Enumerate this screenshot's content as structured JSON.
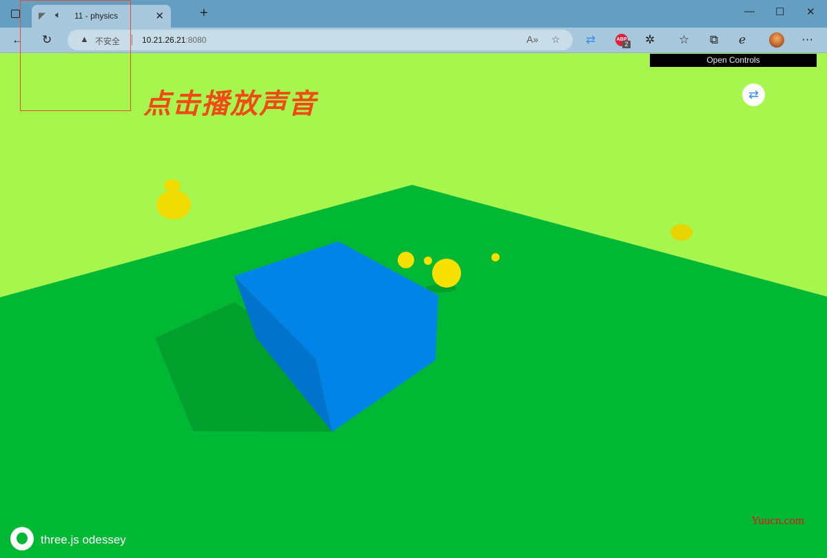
{
  "browser": {
    "tab_title": "11 - physics",
    "url_host": "10.21.26.21",
    "url_port": ":8080",
    "security_label": "不安全",
    "adblock_badge": "ABP",
    "adblock_count": "2"
  },
  "page": {
    "gui_toggle": "Open Controls",
    "heading": "点击播放声音",
    "footer_link": "three.js odessey",
    "watermark": "Yuucn.com"
  },
  "colors": {
    "sky": "#a6f64e",
    "ground": "#00b834",
    "cube": "#0084e8",
    "spheres": "#f5e000",
    "heading": "#f04a17"
  }
}
